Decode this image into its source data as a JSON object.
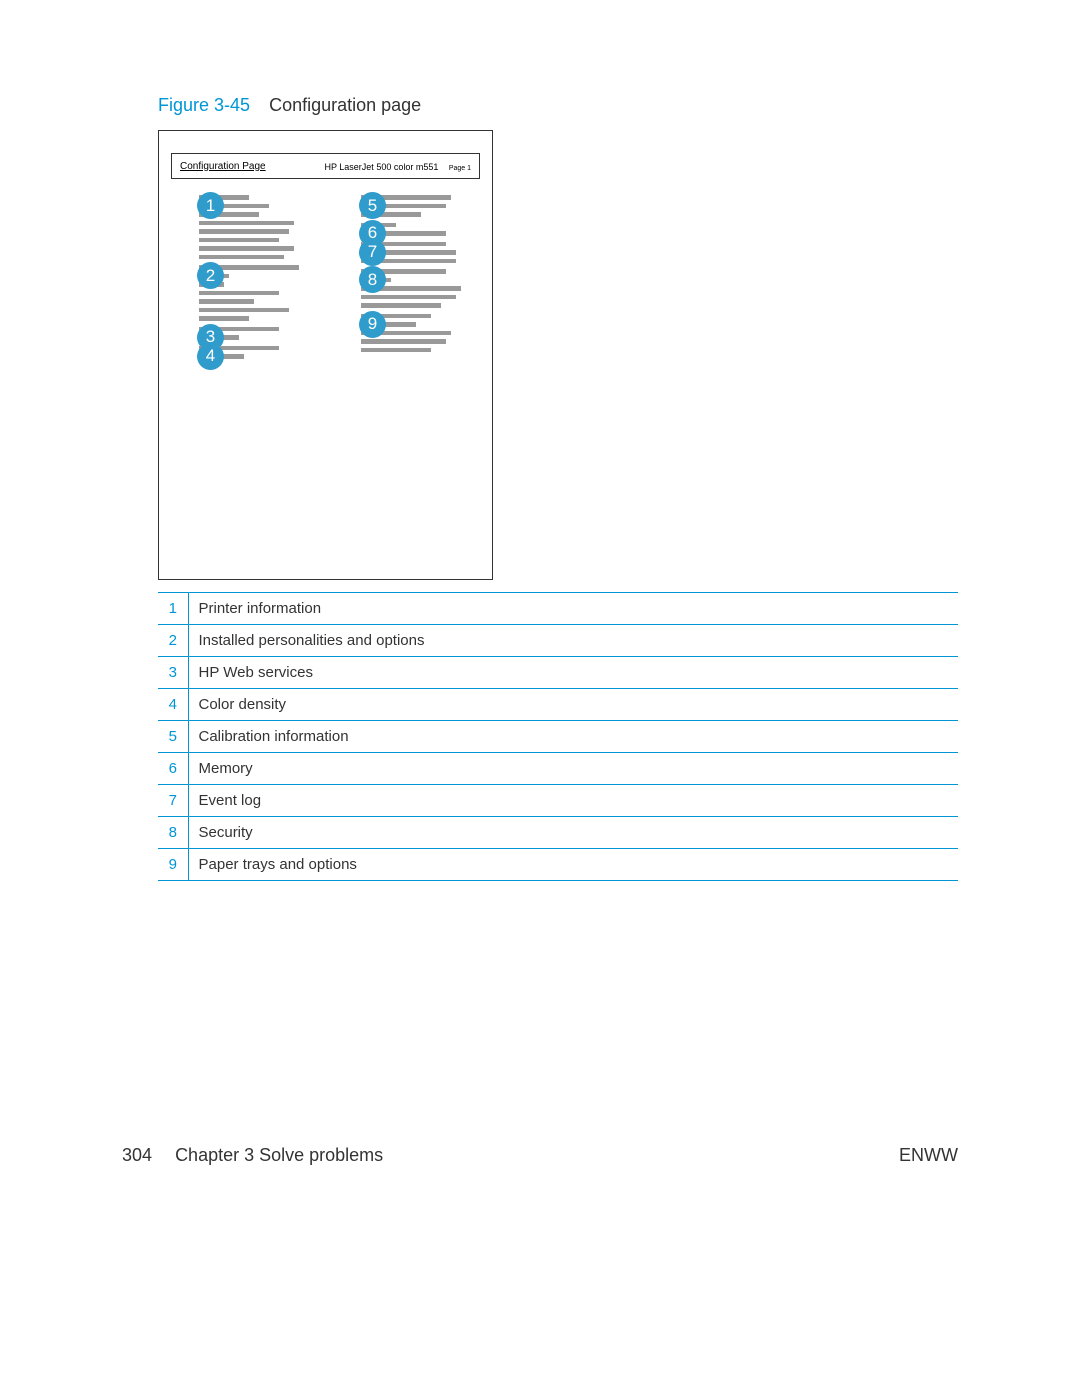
{
  "figure": {
    "label": "Figure 3-45",
    "title": "Configuration page"
  },
  "doc": {
    "cfg_label": "Configuration Page",
    "model": "HP LaserJet 500 color m551",
    "page": "Page 1"
  },
  "callouts": [
    "1",
    "2",
    "3",
    "4",
    "5",
    "6",
    "7",
    "8",
    "9"
  ],
  "legend": [
    {
      "num": "1",
      "desc": "Printer information"
    },
    {
      "num": "2",
      "desc": "Installed personalities and options"
    },
    {
      "num": "3",
      "desc": "HP Web services"
    },
    {
      "num": "4",
      "desc": "Color density"
    },
    {
      "num": "5",
      "desc": "Calibration information"
    },
    {
      "num": "6",
      "desc": "Memory"
    },
    {
      "num": "7",
      "desc": "Event log"
    },
    {
      "num": "8",
      "desc": "Security"
    },
    {
      "num": "9",
      "desc": "Paper trays and options"
    }
  ],
  "footer": {
    "page_num": "304",
    "chapter": "Chapter 3   Solve problems",
    "lang": "ENWW"
  }
}
